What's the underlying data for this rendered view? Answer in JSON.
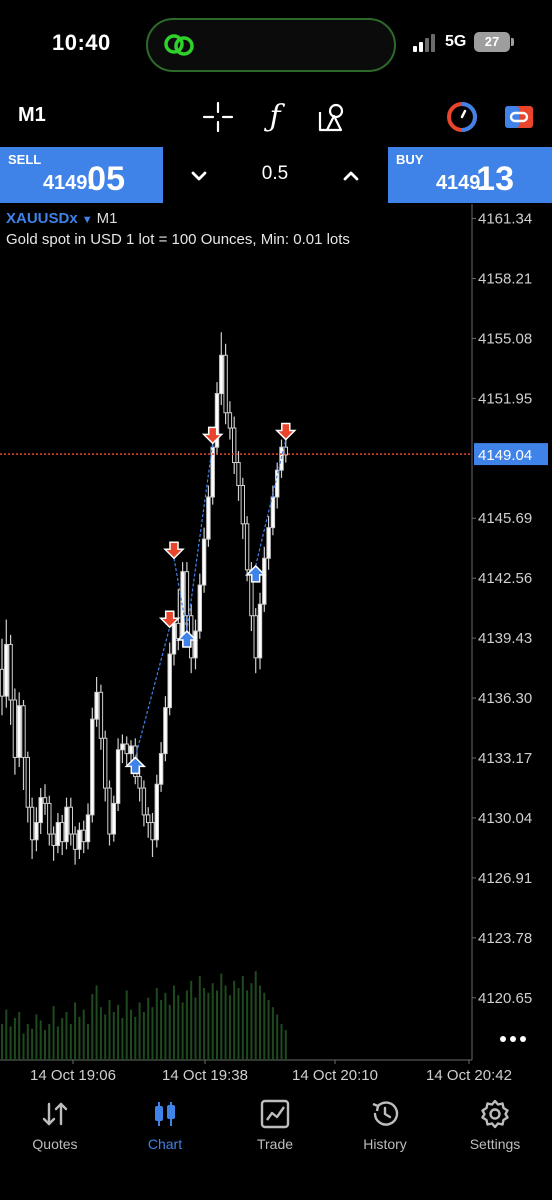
{
  "status_bar": {
    "time": "10:40",
    "network": "5G",
    "battery": "27"
  },
  "toolbar": {
    "timeframe": "M1",
    "indicator_glyph": "ƒ",
    "icons": [
      "crosshair-icon",
      "indicator-icon",
      "objects-icon",
      "profile-icon",
      "account-icon"
    ],
    "profile_colors": [
      "#e8452c",
      "#3f82e8"
    ]
  },
  "trade": {
    "sell_label": "SELL",
    "sell_price_small": "4149.",
    "sell_price_big": "05",
    "buy_label": "BUY",
    "buy_price_small": "4149.",
    "buy_price_big": "13",
    "lot": "0.5",
    "accent_color": "#3f82e8"
  },
  "chart": {
    "symbol": "XAUUSDx",
    "timeframe": "M1",
    "description": "Gold spot in USD 1 lot = 100 Ounces, Min: 0.01 lots",
    "current_price": "4149.04"
  },
  "chart_data": {
    "type": "candlestick",
    "y_ticks": [
      "4161.34",
      "4158.21",
      "4155.08",
      "4151.95",
      "4149.04",
      "4145.69",
      "4142.56",
      "4139.43",
      "4136.30",
      "4133.17",
      "4130.04",
      "4126.91",
      "4123.78",
      "4120.65"
    ],
    "x_ticks": [
      "14 Oct 19:06",
      "14 Oct 19:38",
      "14 Oct 20:10",
      "14 Oct 20:42"
    ],
    "ylim": [
      4117.4,
      4162.1
    ],
    "current_price": 4149.04,
    "candles": [
      [
        4137.8,
        4136.4,
        4139.4,
        4135.4
      ],
      [
        4136.4,
        4139.1,
        4140.4,
        4135.8
      ],
      [
        4139.1,
        4136.2,
        4139.6,
        4134.9
      ],
      [
        4136.2,
        4133.2,
        4136.8,
        4132.3
      ],
      [
        4133.2,
        4135.9,
        4136.6,
        4132.7
      ],
      [
        4135.9,
        4133.2,
        4136.2,
        4131.5
      ],
      [
        4133.2,
        4130.6,
        4133.5,
        4129.8
      ],
      [
        4130.6,
        4128.9,
        4131.1,
        4127.9
      ],
      [
        4128.9,
        4129.8,
        4130.6,
        4128.3
      ],
      [
        4129.8,
        4131.1,
        4131.6,
        4129.2
      ],
      [
        4131.1,
        4130.8,
        4131.8,
        4130.2
      ],
      [
        4130.8,
        4129.2,
        4131.2,
        4128.6
      ],
      [
        4129.2,
        4128.6,
        4129.6,
        4127.8
      ],
      [
        4128.6,
        4129.8,
        4130.3,
        4128.2
      ],
      [
        4129.8,
        4128.8,
        4130.2,
        4128.1
      ],
      [
        4128.8,
        4130.6,
        4131.1,
        4128.4
      ],
      [
        4130.6,
        4129.2,
        4131.1,
        4128.6
      ],
      [
        4129.2,
        4128.4,
        4129.6,
        4127.6
      ],
      [
        4128.4,
        4129.4,
        4129.8,
        4127.9
      ],
      [
        4129.4,
        4128.8,
        4129.9,
        4128.2
      ],
      [
        4128.8,
        4130.2,
        4130.8,
        4128.4
      ],
      [
        4130.2,
        4135.2,
        4135.8,
        4129.8
      ],
      [
        4135.2,
        4136.6,
        4137.4,
        4134.8
      ],
      [
        4136.6,
        4134.2,
        4137.0,
        4133.6
      ],
      [
        4134.2,
        4131.6,
        4134.6,
        4130.9
      ],
      [
        4131.6,
        4129.2,
        4132.0,
        4128.6
      ],
      [
        4129.2,
        4130.8,
        4131.2,
        4128.8
      ],
      [
        4130.8,
        4133.6,
        4134.2,
        4130.4
      ],
      [
        4133.6,
        4133.9,
        4134.4,
        4132.9
      ],
      [
        4133.9,
        4133.4,
        4134.3,
        4132.8
      ],
      [
        4133.4,
        4133.8,
        4134.1,
        4132.9
      ],
      [
        4133.8,
        4132.2,
        4134.2,
        4131.8
      ],
      [
        4132.2,
        4131.6,
        4132.6,
        4130.9
      ],
      [
        4131.6,
        4130.2,
        4132.0,
        4129.6
      ],
      [
        4130.2,
        4129.8,
        4130.6,
        4129.0
      ],
      [
        4129.8,
        4128.9,
        4130.3,
        4128.0
      ],
      [
        4128.9,
        4131.8,
        4132.3,
        4128.5
      ],
      [
        4131.8,
        4133.4,
        4134.0,
        4131.4
      ],
      [
        4133.4,
        4135.8,
        4136.4,
        4133.0
      ],
      [
        4135.8,
        4138.6,
        4139.2,
        4135.4
      ],
      [
        4138.6,
        4140.2,
        4140.8,
        4138.0
      ],
      [
        4140.2,
        4139.4,
        4142.0,
        4138.8
      ],
      [
        4139.4,
        4142.9,
        4143.4,
        4139.0
      ],
      [
        4142.9,
        4140.6,
        4143.4,
        4139.8
      ],
      [
        4140.6,
        4138.4,
        4141.2,
        4137.6
      ],
      [
        4138.4,
        4139.8,
        4140.4,
        4137.8
      ],
      [
        4139.8,
        4142.2,
        4142.8,
        4139.4
      ],
      [
        4142.2,
        4144.6,
        4145.2,
        4141.8
      ],
      [
        4144.6,
        4146.8,
        4147.4,
        4144.2
      ],
      [
        4146.8,
        4149.4,
        4150.0,
        4146.4
      ],
      [
        4149.4,
        4152.2,
        4152.8,
        4149.0
      ],
      [
        4152.2,
        4154.2,
        4155.4,
        4151.6
      ],
      [
        4154.2,
        4151.2,
        4154.8,
        4150.6
      ],
      [
        4151.2,
        4150.4,
        4151.8,
        4149.8
      ],
      [
        4150.4,
        4148.6,
        4151.0,
        4148.0
      ],
      [
        4148.6,
        4147.4,
        4149.2,
        4146.6
      ],
      [
        4147.4,
        4145.4,
        4147.8,
        4144.6
      ],
      [
        4145.4,
        4143.0,
        4145.8,
        4142.4
      ],
      [
        4143.0,
        4140.6,
        4143.4,
        4139.8
      ],
      [
        4140.6,
        4138.4,
        4141.0,
        4137.6
      ],
      [
        4138.4,
        4141.2,
        4141.8,
        4137.8
      ],
      [
        4141.2,
        4143.6,
        4144.2,
        4140.8
      ],
      [
        4143.6,
        4145.2,
        4145.8,
        4143.0
      ],
      [
        4145.2,
        4146.8,
        4147.4,
        4144.8
      ],
      [
        4146.8,
        4148.2,
        4148.6,
        4146.2
      ],
      [
        4148.2,
        4149.4,
        4149.8,
        4147.8
      ],
      [
        4149.4,
        4149.0,
        4149.8,
        4148.6
      ]
    ],
    "volumes": [
      0.3,
      0.42,
      0.28,
      0.35,
      0.4,
      0.22,
      0.3,
      0.26,
      0.38,
      0.33,
      0.25,
      0.3,
      0.45,
      0.28,
      0.35,
      0.4,
      0.3,
      0.48,
      0.36,
      0.42,
      0.3,
      0.55,
      0.62,
      0.44,
      0.38,
      0.5,
      0.4,
      0.46,
      0.35,
      0.58,
      0.42,
      0.36,
      0.48,
      0.4,
      0.52,
      0.44,
      0.6,
      0.5,
      0.56,
      0.46,
      0.62,
      0.54,
      0.48,
      0.58,
      0.66,
      0.52,
      0.7,
      0.6,
      0.56,
      0.64,
      0.58,
      0.72,
      0.62,
      0.54,
      0.66,
      0.6,
      0.7,
      0.58,
      0.64,
      0.74,
      0.62,
      0.56,
      0.5,
      0.44,
      0.38,
      0.3,
      0.25
    ],
    "trades": [
      {
        "side": "buy",
        "index": 31,
        "price": 4133.2
      },
      {
        "side": "sell",
        "index": 39,
        "price": 4140.0
      },
      {
        "side": "sell",
        "index": 40,
        "price": 4143.6
      },
      {
        "side": "buy",
        "index": 43,
        "price": 4139.8
      },
      {
        "side": "sell",
        "index": 49,
        "price": 4149.6
      },
      {
        "side": "buy",
        "index": 59,
        "price": 4143.2
      },
      {
        "side": "sell",
        "index": 66,
        "price": 4149.8
      }
    ]
  },
  "nav": {
    "items": [
      {
        "label": "Quotes",
        "icon": "quotes-icon"
      },
      {
        "label": "Chart",
        "icon": "chart-icon"
      },
      {
        "label": "Trade",
        "icon": "trade-icon"
      },
      {
        "label": "History",
        "icon": "history-icon"
      },
      {
        "label": "Settings",
        "icon": "settings-icon"
      }
    ],
    "active": "Chart"
  }
}
